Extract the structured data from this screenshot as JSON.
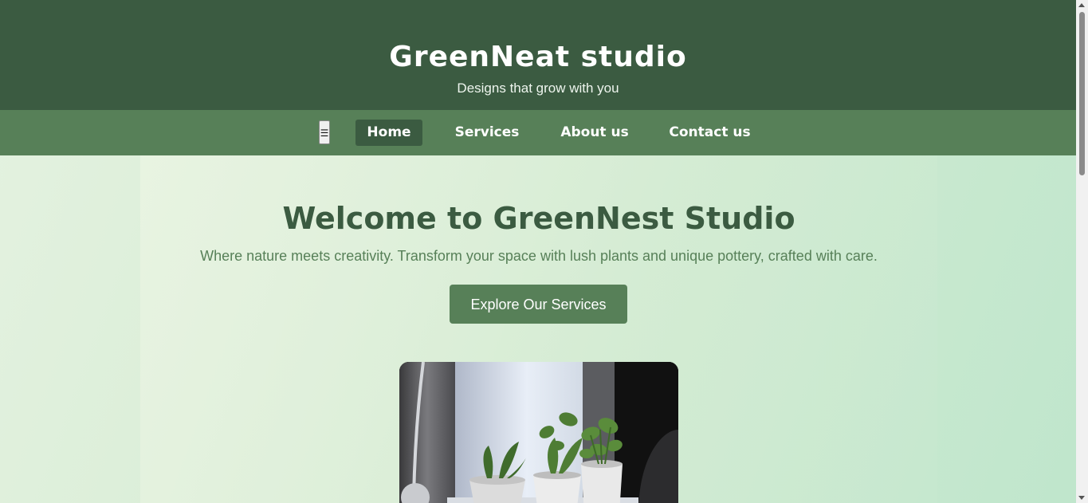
{
  "header": {
    "title": "GreenNeat studio",
    "tagline": "Designs that grow with you",
    "background_color": "#3b5b41"
  },
  "nav": {
    "menu_toggle_icon": "☰",
    "menu_toggle_name": "hamburger-menu-icon",
    "items": [
      {
        "label": "Home",
        "active": true
      },
      {
        "label": "Services",
        "active": false
      },
      {
        "label": "About us",
        "active": false
      },
      {
        "label": "Contact us",
        "active": false
      }
    ],
    "background_color": "#578058"
  },
  "hero": {
    "title": "Welcome to GreenNest Studio",
    "subtitle": "Where nature meets creativity. Transform your space with lush plants and unique pottery, crafted with care.",
    "cta_label": "Explore Our Services",
    "image_subject": "potted plants on windowsill"
  },
  "colors": {
    "accent": "#578058",
    "dark": "#3b5b41"
  }
}
